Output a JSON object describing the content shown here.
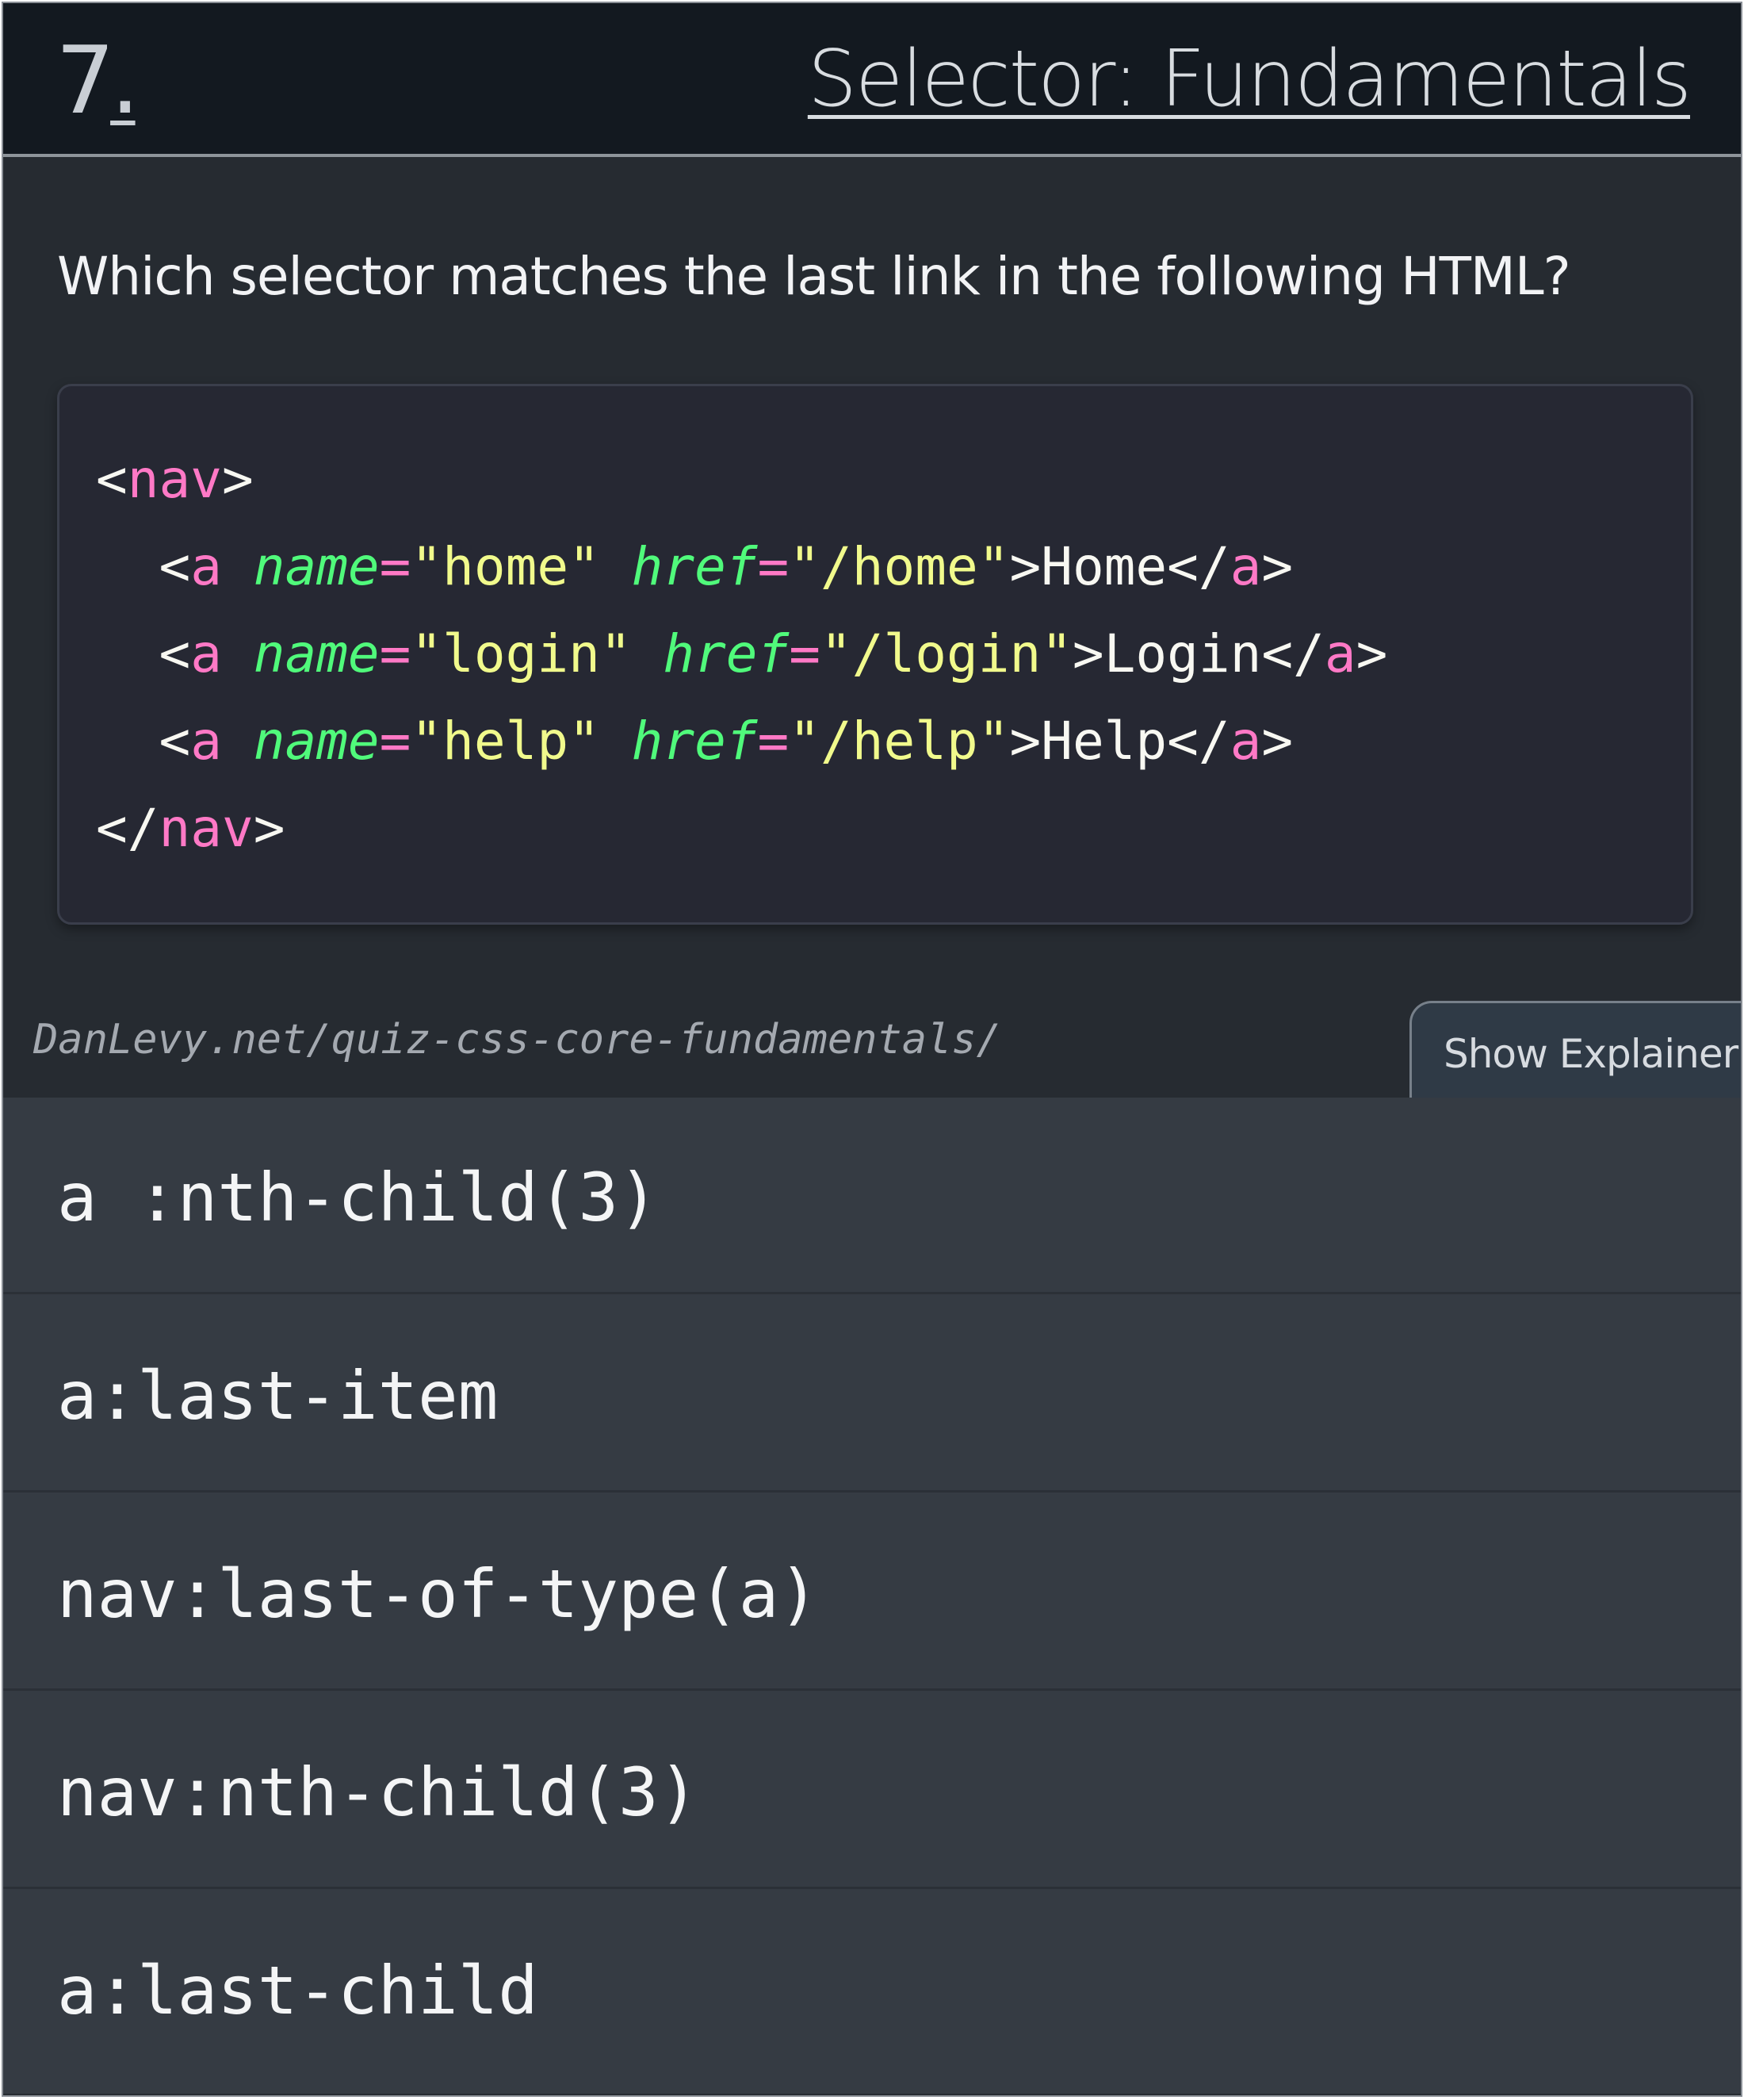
{
  "header": {
    "question_number": "7",
    "number_suffix": ".",
    "section_title": "Selector: Fundamentals"
  },
  "question": {
    "text": "Which selector matches the last link in the following HTML?"
  },
  "code": {
    "lines": [
      [
        [
          "punct",
          "<"
        ],
        [
          "tag",
          "nav"
        ],
        [
          "punct",
          ">"
        ]
      ],
      [
        [
          "punct",
          "  <"
        ],
        [
          "tag",
          "a"
        ],
        [
          "punct",
          " "
        ],
        [
          "attr",
          "name"
        ],
        [
          "eq",
          "="
        ],
        [
          "str",
          "\"home\""
        ],
        [
          "punct",
          " "
        ],
        [
          "attr",
          "href"
        ],
        [
          "eq",
          "="
        ],
        [
          "str",
          "\"/home\""
        ],
        [
          "punct",
          ">"
        ],
        [
          "text",
          "Home"
        ],
        [
          "punct",
          "</"
        ],
        [
          "tag",
          "a"
        ],
        [
          "punct",
          ">"
        ]
      ],
      [
        [
          "punct",
          "  <"
        ],
        [
          "tag",
          "a"
        ],
        [
          "punct",
          " "
        ],
        [
          "attr",
          "name"
        ],
        [
          "eq",
          "="
        ],
        [
          "str",
          "\"login\""
        ],
        [
          "punct",
          " "
        ],
        [
          "attr",
          "href"
        ],
        [
          "eq",
          "="
        ],
        [
          "str",
          "\"/login\""
        ],
        [
          "punct",
          ">"
        ],
        [
          "text",
          "Login"
        ],
        [
          "punct",
          "</"
        ],
        [
          "tag",
          "a"
        ],
        [
          "punct",
          ">"
        ]
      ],
      [
        [
          "punct",
          "  <"
        ],
        [
          "tag",
          "a"
        ],
        [
          "punct",
          " "
        ],
        [
          "attr",
          "name"
        ],
        [
          "eq",
          "="
        ],
        [
          "str",
          "\"help\""
        ],
        [
          "punct",
          " "
        ],
        [
          "attr",
          "href"
        ],
        [
          "eq",
          "="
        ],
        [
          "str",
          "\"/help\""
        ],
        [
          "punct",
          ">"
        ],
        [
          "text",
          "Help"
        ],
        [
          "punct",
          "</"
        ],
        [
          "tag",
          "a"
        ],
        [
          "punct",
          ">"
        ]
      ],
      [
        [
          "punct",
          "</"
        ],
        [
          "tag",
          "nav"
        ],
        [
          "punct",
          ">"
        ]
      ]
    ]
  },
  "source": {
    "url_text": "DanLevy.net/quiz-css-core-fundamentals/"
  },
  "explainer": {
    "label": "Show Explainer"
  },
  "answers": [
    {
      "label": "a :nth-child(3)"
    },
    {
      "label": "a:last-item"
    },
    {
      "label": "nav:last-of-type(a)"
    },
    {
      "label": "nav:nth-child(3)"
    },
    {
      "label": "a:last-child"
    }
  ],
  "colors": {
    "tag": "#ff79c6",
    "attr": "#50fa7b",
    "string": "#f1fa8c",
    "text": "#f8f8f2"
  }
}
